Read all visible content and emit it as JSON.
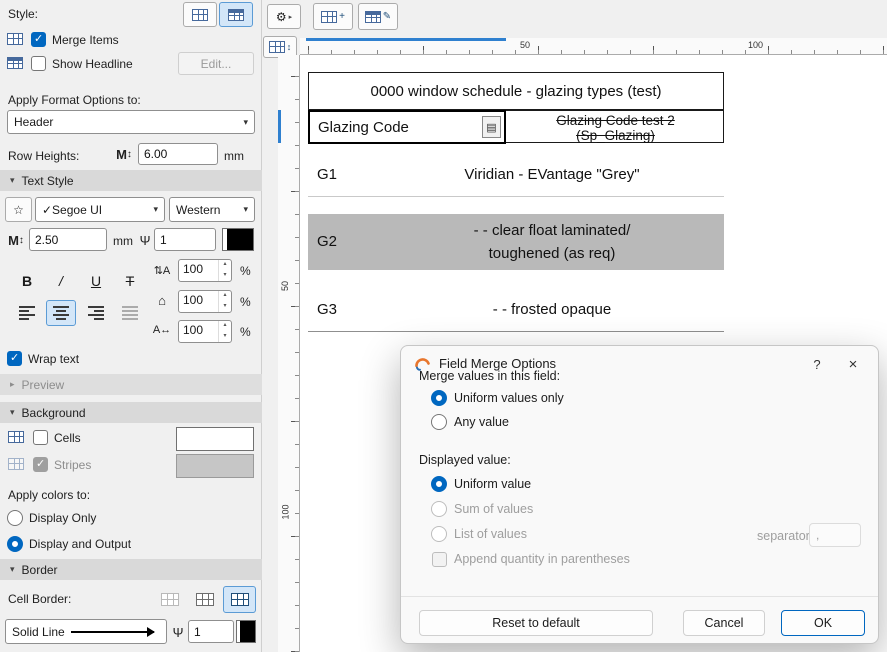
{
  "colors": {
    "accent": "#0067c0",
    "row_highlight": "#b9b9b9"
  },
  "icons": {
    "gear": "⚙",
    "flyout": "▸",
    "chevron": "▾",
    "tri_down": "▾",
    "tri_right": "▸",
    "star": "☆",
    "pen": "Ψ",
    "m_height": "M",
    "updown": "↕",
    "line_spacing": "⇅A",
    "width_factor": "⌂",
    "spacing_factor": "A↔",
    "merge_cell": "▤",
    "spin_up": "▴",
    "spin_down": "▾",
    "plus": "+",
    "edit": "✎"
  },
  "sidebar": {
    "style_label": "Style:",
    "merge_items_label": "Merge Items",
    "show_headline_label": "Show Headline",
    "edit_button_label": "Edit...",
    "apply_format_label": "Apply Format Options to:",
    "format_target_value": "Header",
    "row_heights_label": "Row Heights:",
    "row_height_value": "6.00",
    "row_height_unit": "mm",
    "text_style_section_label": "Text Style",
    "font_value": "✓Segoe UI",
    "script_value": "Western",
    "font_size_value": "2.50",
    "font_size_unit": "mm",
    "text_pen_value": "1",
    "bold_label": "B",
    "italic_label": "/",
    "underline_label": "U",
    "strike_label": "T",
    "line_spacing_value": "100",
    "width_factor_value": "100",
    "spacing_factor_value": "100",
    "percent": "%",
    "wrap_text_label": "Wrap text",
    "preview_section_label": "Preview",
    "background_section_label": "Background",
    "cells_label": "Cells",
    "stripes_label": "Stripes",
    "apply_colors_label": "Apply colors to:",
    "display_only_label": "Display Only",
    "display_and_output_label": "Display and Output",
    "border_section_label": "Border",
    "cell_border_label": "Cell Border:",
    "line_type_value": "Solid Line",
    "border_pen_value": "1"
  },
  "ruler": {
    "h_tick_50": "50",
    "h_tick_100": "100",
    "v_tick_50": "50",
    "v_tick_100": "100"
  },
  "schedule": {
    "title": "0000 window schedule - glazing types (test)",
    "header_cell_text": "Glazing Code",
    "header_alt_line1": "Glazing Code test 2",
    "header_alt_line2": "(Sp_Glazing)",
    "rows": [
      {
        "code": "G1",
        "desc_line1": "Viridian -  EVantage \"Grey\"",
        "desc_line2": ""
      },
      {
        "code": "G2",
        "desc_line1": "- -  clear float laminated/",
        "desc_line2": "toughened (as req)"
      },
      {
        "code": "G3",
        "desc_line1": "- -  frosted opaque",
        "desc_line2": ""
      }
    ]
  },
  "dialog": {
    "title": "Field Merge Options",
    "help_label": "?",
    "close_label": "×",
    "merge_group_label": "Merge values in this field:",
    "option_uniform_only": "Uniform values only",
    "option_any_value": "Any value",
    "displayed_group_label": "Displayed value:",
    "option_uniform_value": "Uniform value",
    "option_sum_values": "Sum of values",
    "option_list_values": "List of values",
    "separator_label": "separator:",
    "separator_value": ",",
    "option_append_quantity": "Append quantity in parentheses",
    "reset_button": "Reset to default",
    "cancel_button": "Cancel",
    "ok_button": "OK"
  }
}
